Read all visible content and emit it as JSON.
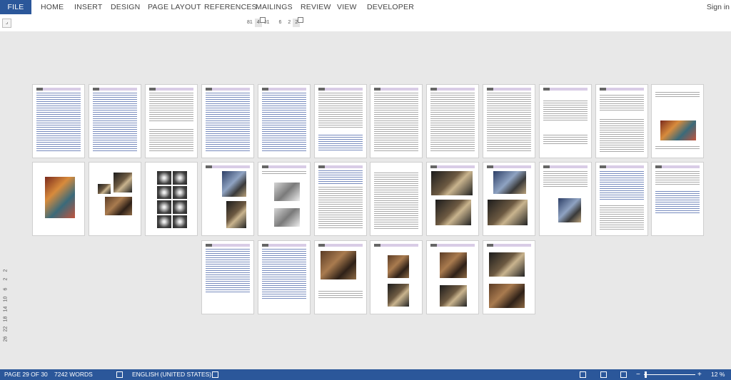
{
  "ribbon": {
    "file": "FILE",
    "tabs": [
      "HOME",
      "INSERT",
      "DESIGN",
      "PAGE LAYOUT",
      "REFERENCES",
      "MAILINGS",
      "REVIEW",
      "VIEW",
      "DEVELOPER"
    ],
    "sign_in": "Sign in"
  },
  "ruler": {
    "horizontal": [
      "81",
      "4",
      "01",
      "6",
      "2",
      "2"
    ],
    "vertical": [
      "2",
      "2",
      "6",
      "10",
      "14",
      "18",
      "22",
      "26"
    ]
  },
  "status_bar": {
    "page": "PAGE 29 OF 30",
    "words": "7242 WORDS",
    "language": "ENGLISH (UNITED STATES)",
    "zoom_minus": "−",
    "zoom_plus": "+",
    "zoom_level": "12 %"
  },
  "colors": {
    "accent": "#2b579a",
    "page_header": "#d9cce6"
  }
}
